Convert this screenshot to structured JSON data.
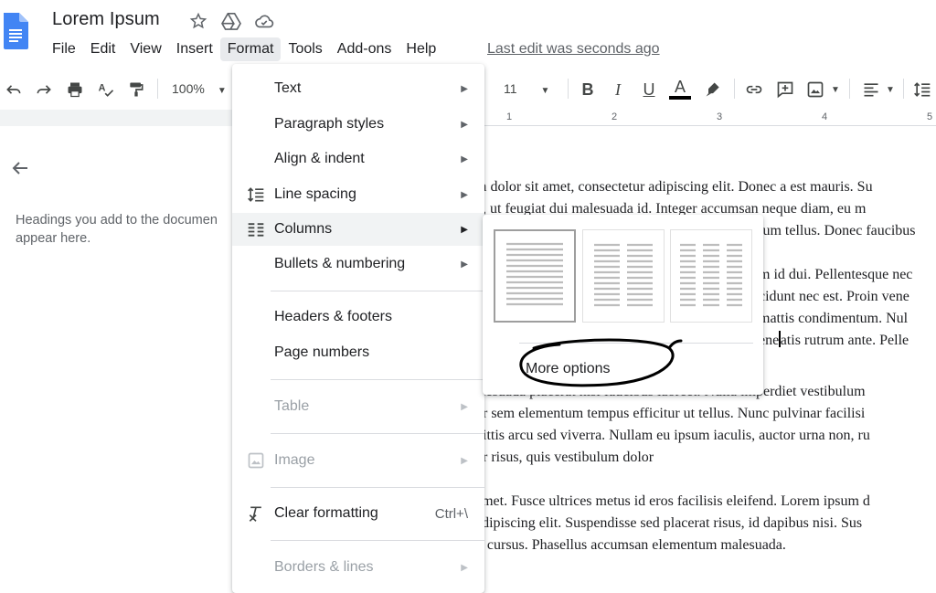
{
  "header": {
    "doc_title": "Lorem Ipsum",
    "last_edit": "Last edit was seconds ago",
    "icons": [
      "star-icon",
      "move-to-drive-icon",
      "cloud-saved-icon"
    ]
  },
  "menubar": {
    "items": [
      "File",
      "Edit",
      "View",
      "Insert",
      "Format",
      "Tools",
      "Add-ons",
      "Help"
    ],
    "active": "Format"
  },
  "toolbar": {
    "zoom": "100%",
    "font_size": "11",
    "bold": "B",
    "italic": "I",
    "underline": "U",
    "text_color": "A"
  },
  "ruler": {
    "numbers": [
      "1",
      "2",
      "3",
      "4",
      "5"
    ]
  },
  "outline": {
    "hint_line1": "Headings you add to the documen",
    "hint_line2": "appear here."
  },
  "document": {
    "p1": [
      "m dolor sit amet, consectetur adipiscing elit. Donec a est mauris. Su",
      "n, ut feugiat dui malesuada id. Integer accumsan neque diam, eu m",
      "tum tellus. Donec faucibus"
    ],
    "p2": [
      "m id dui. Pellentesque nec",
      "cidunt nec est. Proin vene",
      "mattis condimentum. Nul",
      "ene",
      "atis rutrum ante. Pelle"
    ],
    "p3": [
      "alesuada placerat nisi faucibus laoreet. Nulla imperdiet vestibulum",
      "or sem elementum tempus efficitur ut tellus. Nunc pulvinar facilisi",
      "gittis arcu sed viverra. Nullam eu ipsum iaculis, auctor urna non, ru",
      "or risus, quis vestibulum dolor"
    ],
    "p4": [
      "amet. Fusce ultrices metus id eros facilisis eleifend. Lorem ipsum d",
      "adipiscing elit. Suspendisse sed placerat risus, id dapibus nisi. Sus",
      "it cursus. Phasellus accumsan elementum malesuada."
    ]
  },
  "format_menu": {
    "text": "Text",
    "paragraph_styles": "Paragraph styles",
    "align_indent": "Align & indent",
    "line_spacing": "Line spacing",
    "columns": "Columns",
    "bullets_numbering": "Bullets & numbering",
    "headers_footers": "Headers & footers",
    "page_numbers": "Page numbers",
    "table": "Table",
    "image": "Image",
    "clear_formatting": "Clear formatting",
    "clear_formatting_shortcut": "Ctrl+\\",
    "borders_lines": "Borders & lines"
  },
  "columns_submenu": {
    "options": [
      "one-column",
      "two-columns",
      "three-columns"
    ],
    "selected": "one-column",
    "more_options": "More options"
  },
  "colors": {
    "docs_blue": "#4285f4",
    "menu_highlight": "#f1f3f4",
    "text_color_underline": "#000000"
  }
}
